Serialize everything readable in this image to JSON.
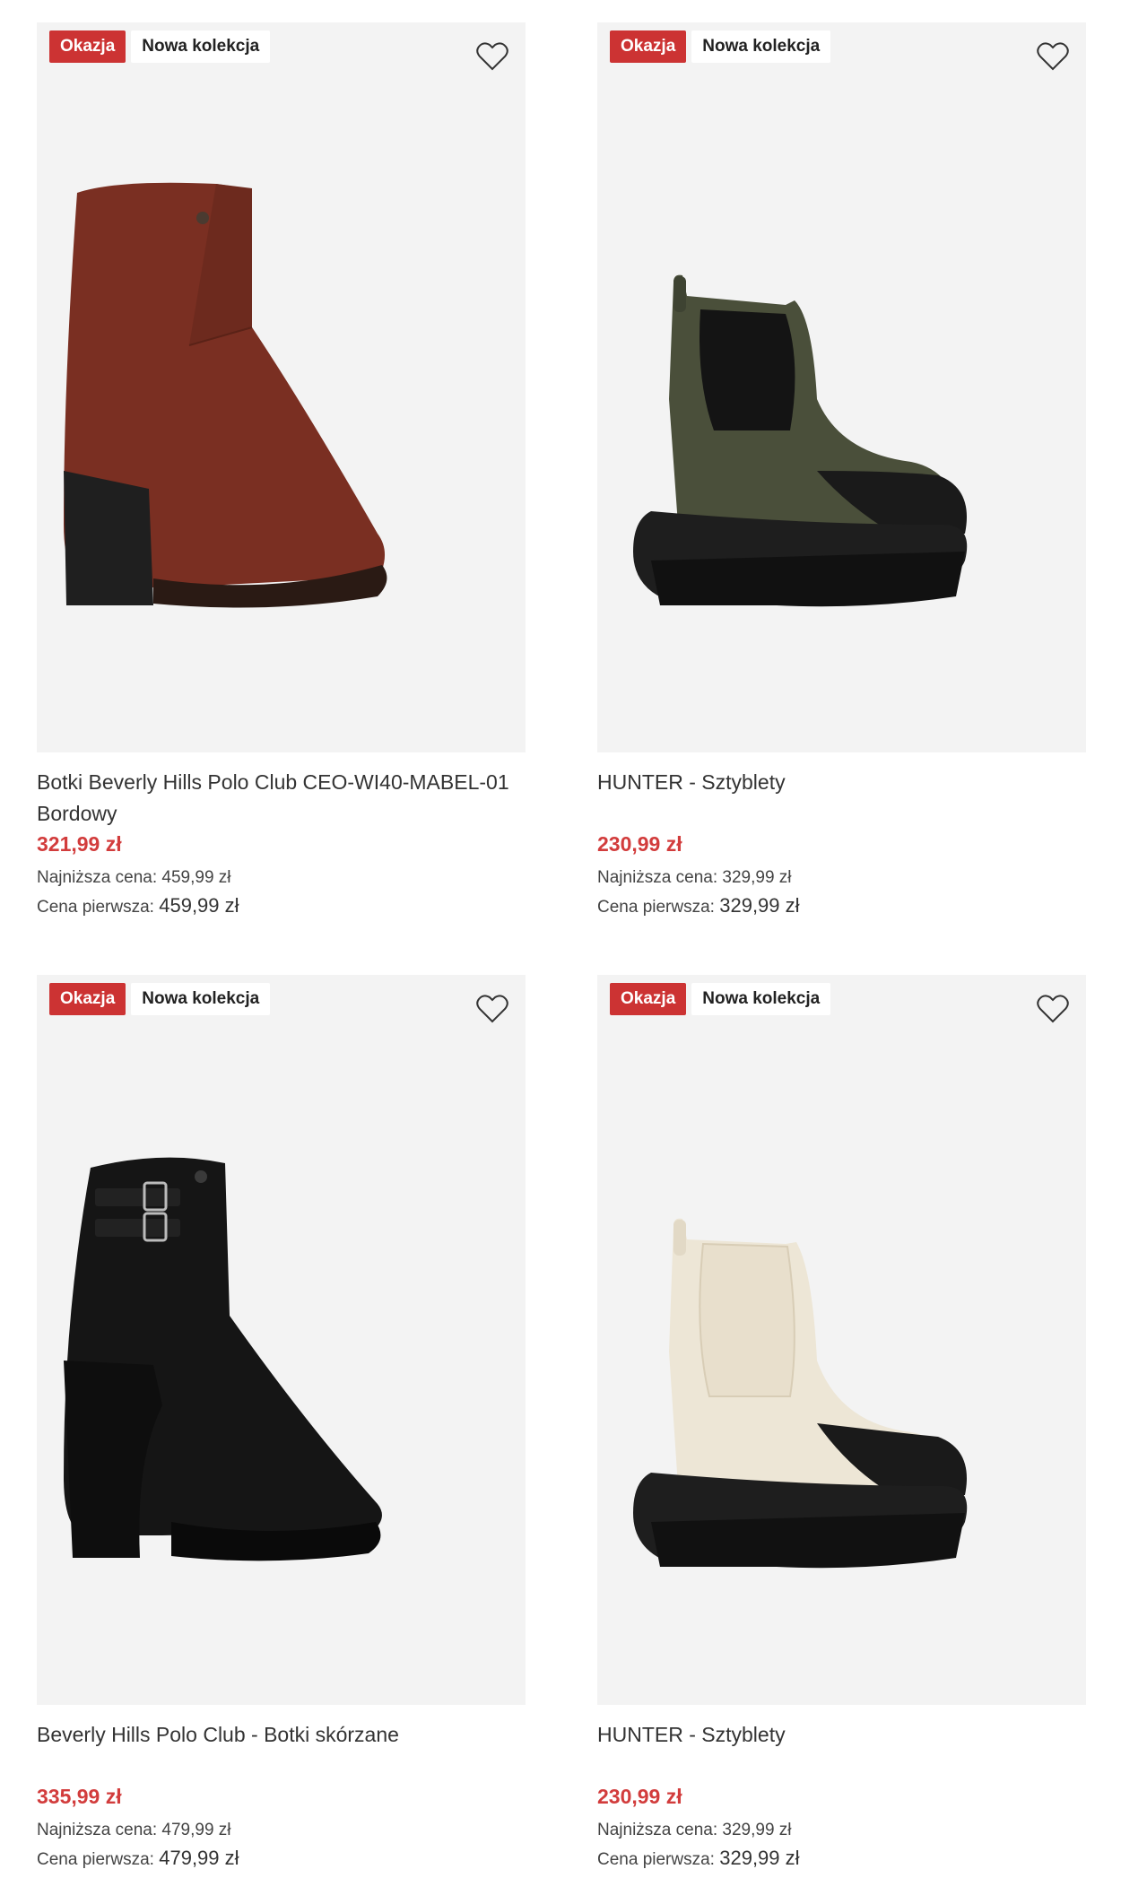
{
  "products": [
    {
      "badge_sale": "Okazja",
      "badge_new": "Nowa kolekcja",
      "title": "Botki Beverly Hills Polo Club CEO-WI40-MABEL-01 Bordowy",
      "price": "321,99 zł",
      "lowest_label": "Najniższa cena:",
      "lowest_value": "459,99 zł",
      "first_label": "Cena pierwsza:",
      "first_value": "459,99 zł",
      "color": "#7a2f22"
    },
    {
      "badge_sale": "Okazja",
      "badge_new": "Nowa kolekcja",
      "title": "HUNTER - Sztyblety",
      "price": "230,99 zł",
      "lowest_label": "Najniższa cena:",
      "lowest_value": "329,99 zł",
      "first_label": "Cena pierwsza:",
      "first_value": "329,99 zł",
      "color": "#4a4f3a"
    },
    {
      "badge_sale": "Okazja",
      "badge_new": "Nowa kolekcja",
      "title": "Beverly Hills Polo Club - Botki skórzane",
      "price": "335,99 zł",
      "lowest_label": "Najniższa cena:",
      "lowest_value": "479,99 zł",
      "first_label": "Cena pierwsza:",
      "first_value": "479,99 zł",
      "color": "#141414"
    },
    {
      "badge_sale": "Okazja",
      "badge_new": "Nowa kolekcja",
      "title": "HUNTER - Sztyblety",
      "price": "230,99 zł",
      "lowest_label": "Najniższa cena:",
      "lowest_value": "329,99 zł",
      "first_label": "Cena pierwsza:",
      "first_value": "329,99 zł",
      "color": "#ede6d6"
    }
  ],
  "icons": {
    "favorite": "heart-outline-icon"
  },
  "colors": {
    "sale": "#cc3333",
    "price": "#d23c3c"
  }
}
